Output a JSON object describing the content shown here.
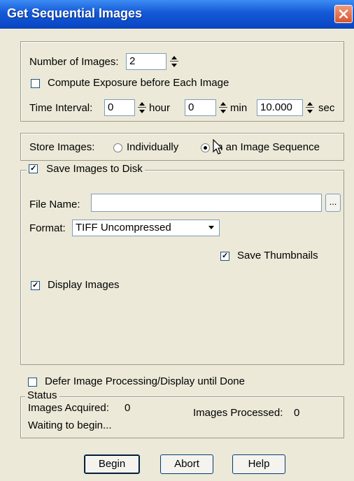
{
  "window": {
    "title": "Get Sequential Images"
  },
  "acquisition": {
    "num_images_label": "Number of Images:",
    "num_images_value": "2",
    "compute_exposure_label": "Compute Exposure before Each Image",
    "compute_exposure_checked": false,
    "time_interval_label": "Time Interval:",
    "hour_value": "0",
    "hour_label": "hour",
    "min_value": "0",
    "min_label": "min",
    "sec_value": "10.000",
    "sec_label": "sec"
  },
  "store": {
    "label": "Store Images:",
    "individually_label": "Individually",
    "sequence_label": "In an Image Sequence",
    "selected": "sequence"
  },
  "save": {
    "group_label": "Save Images to Disk",
    "checked": true,
    "file_name_label": "File Name:",
    "file_name_value": "",
    "browse_label": "...",
    "format_label": "Format:",
    "format_value": "TIFF Uncompressed",
    "thumbnails_label": "Save Thumbnails",
    "thumbnails_checked": true,
    "display_label": "Display Images",
    "display_checked": true
  },
  "defer": {
    "label": "Defer Image Processing/Display until Done",
    "checked": false
  },
  "status": {
    "group_label": "Status",
    "acquired_label": "Images Acquired:",
    "acquired_value": "0",
    "processed_label": "Images Processed:",
    "processed_value": "0",
    "message": "Waiting to begin..."
  },
  "buttons": {
    "begin": "Begin",
    "abort": "Abort",
    "help": "Help"
  },
  "colors": {
    "titlebar": "#1459d6",
    "dialog_bg": "#ece9d8",
    "close": "#d9542c"
  }
}
